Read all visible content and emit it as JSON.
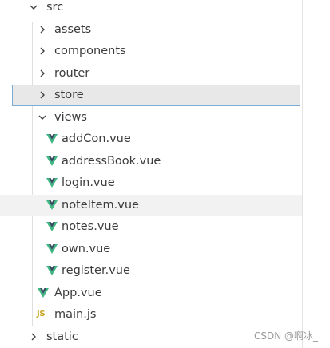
{
  "tree": {
    "src": "src",
    "assets": "assets",
    "components": "components",
    "router": "router",
    "store": "store",
    "views": "views",
    "views_files": [
      "addCon.vue",
      "addressBook.vue",
      "login.vue",
      "noteItem.vue",
      "notes.vue",
      "own.vue",
      "register.vue"
    ],
    "app_vue": "App.vue",
    "main_js": "main.js",
    "main_js_badge": "JS",
    "static": "static"
  },
  "watermark": "CSDN @啊冰_",
  "colors": {
    "vue_green": "#41b883",
    "vue_dark": "#34495e",
    "js_yellow": "#c9a421",
    "selection_border": "#7aacd6"
  },
  "icons": {
    "folder_open": "chevron-down-icon",
    "folder_closed": "chevron-right-icon",
    "vue_file": "vue-file-icon",
    "js_file": "js-file-icon"
  }
}
